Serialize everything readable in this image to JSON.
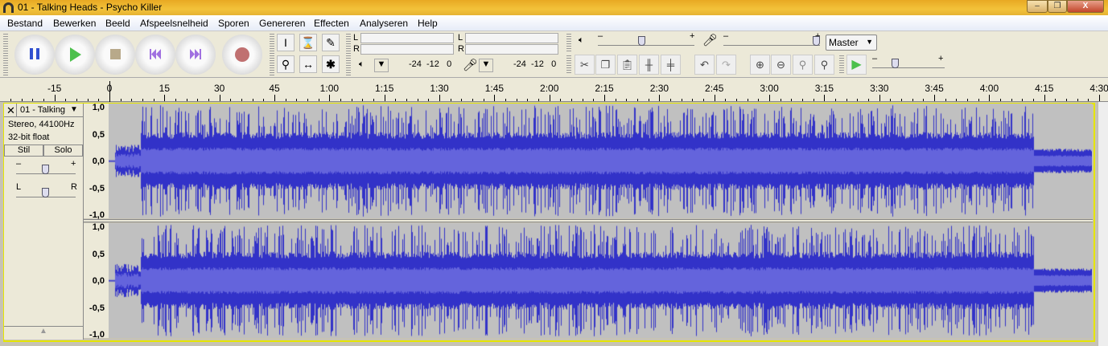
{
  "window": {
    "title": "01 - Talking Heads - Psycho Killer",
    "minimize": "–",
    "restore": "❐",
    "close": "X"
  },
  "menu": [
    "Bestand",
    "Bewerken",
    "Beeld",
    "Afspeelsnelheid",
    "Sporen",
    "Genereren",
    "Effecten",
    "Analyseren",
    "Help"
  ],
  "meters": {
    "play_l": "L",
    "play_r": "R",
    "rec_l": "L",
    "rec_r": "R",
    "play_scale": "-24  -12   0",
    "rec_scale": "-24  -12   0"
  },
  "mixer": {
    "minus": "–",
    "plus": "+",
    "device": "Master",
    "play_volume": 0.45,
    "rec_volume": 1.0,
    "play_speed": 0.3
  },
  "ruler": {
    "labels": [
      "-15",
      "0",
      "15",
      "30",
      "45",
      "1:00",
      "1:15",
      "1:30",
      "1:45",
      "2:00",
      "2:15",
      "2:30",
      "2:45",
      "3:00",
      "3:15",
      "3:30",
      "3:45",
      "4:00",
      "4:15",
      "4:30"
    ]
  },
  "track": {
    "name": "01 - Talking",
    "format": "Stereo, 44100Hz",
    "bits": "32-bit float",
    "mute": "Stil",
    "solo": "Solo",
    "gain_minus": "–",
    "gain_plus": "+",
    "pan_l": "L",
    "pan_r": "R",
    "scale": [
      "1,0",
      "0,5",
      "0,0",
      "-0,5",
      "-1,0"
    ],
    "colors": {
      "wave": "#3232c8",
      "rms": "#6464dc",
      "bg": "#c0c0c0"
    }
  }
}
